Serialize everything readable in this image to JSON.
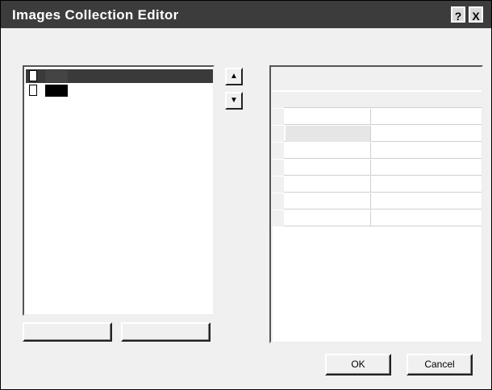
{
  "window": {
    "title": "Images Collection Editor",
    "help_glyph": "?",
    "close_glyph": "X"
  },
  "members": {
    "label": "",
    "items": [
      {
        "index": "",
        "name": ""
      },
      {
        "index": "",
        "name": ""
      }
    ],
    "up_glyph": "▲",
    "down_glyph": "▼",
    "add_label": "",
    "remove_label": ""
  },
  "properties": {
    "label": "",
    "categorized_glyph": "",
    "alphabetical_glyph": "",
    "pages_glyph": "",
    "category_misc": "",
    "rows": [
      {
        "name": "",
        "value": ""
      },
      {
        "name": "",
        "value": ""
      },
      {
        "name": "",
        "value": ""
      },
      {
        "name": "",
        "value": ""
      },
      {
        "name": "",
        "value": ""
      },
      {
        "name": "",
        "value": ""
      },
      {
        "name": "",
        "value": ""
      }
    ]
  },
  "buttons": {
    "ok": "OK",
    "cancel": "Cancel"
  }
}
